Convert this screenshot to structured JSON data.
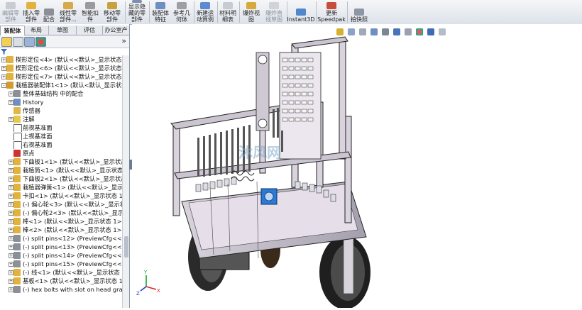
{
  "ribbon": {
    "buttons": [
      {
        "label": "编辑零\n部件",
        "disabled": true
      },
      {
        "label": "插入零\n部件",
        "disabled": false
      },
      {
        "label": "配合",
        "disabled": false
      },
      {
        "label": "线性零\n部件...",
        "disabled": false
      },
      {
        "label": "智能扣\n件",
        "disabled": false
      },
      {
        "label": "移动零\n部件",
        "disabled": false
      },
      {
        "label": "显示隐\n藏的零\n部件",
        "disabled": false
      },
      {
        "label": "装配体\n特征",
        "disabled": false
      },
      {
        "label": "参考几\n何体",
        "disabled": false
      },
      {
        "label": "新建运\n动算例",
        "disabled": false
      },
      {
        "label": "材料明\n细表",
        "disabled": false
      },
      {
        "label": "爆炸视\n图",
        "disabled": false
      },
      {
        "label": "爆炸直\n线草图",
        "disabled": true
      },
      {
        "label": "Instant3D",
        "disabled": false
      },
      {
        "label": "更新\nSpeedpak",
        "disabled": false
      },
      {
        "label": "拍快照",
        "disabled": false
      }
    ]
  },
  "panel_tabs": [
    "装配体",
    "布局",
    "草图",
    "评估",
    "办公室产品"
  ],
  "panel_expand": "»",
  "filter_icon": "filter-icon",
  "tree": [
    {
      "text": "楔形定位<4> (默认<<默认>_显示状态 1",
      "icon": "part",
      "pm": "+",
      "indent": 0
    },
    {
      "text": "楔形定位<6> (默认<<默认>_显示状态 1",
      "icon": "part",
      "pm": "+",
      "indent": 0
    },
    {
      "text": "楔形定位<7> (默认<<默认>_显示状态 1",
      "icon": "part",
      "pm": "+",
      "indent": 0
    },
    {
      "text": "栽植器装配体1<1> (默认<默认_显示状态",
      "icon": "assembly",
      "pm": "-",
      "indent": 0
    },
    {
      "text": "整体基础结构 中的配合",
      "icon": "mates",
      "pm": "+",
      "indent": 1
    },
    {
      "text": "History",
      "icon": "history",
      "pm": "+",
      "indent": 1
    },
    {
      "text": "传感器",
      "icon": "sensor",
      "pm": "",
      "indent": 1
    },
    {
      "text": "注解",
      "icon": "annotation",
      "pm": "+",
      "indent": 1
    },
    {
      "text": "前视基准面",
      "icon": "plane",
      "pm": "",
      "indent": 1
    },
    {
      "text": "上视基准面",
      "icon": "plane",
      "pm": "",
      "indent": 1
    },
    {
      "text": "右视基准面",
      "icon": "plane",
      "pm": "",
      "indent": 1
    },
    {
      "text": "原点",
      "icon": "origin",
      "pm": "",
      "indent": 1
    },
    {
      "text": "下曲板1<1> (默认<<默认>_显示状态",
      "icon": "part",
      "pm": "+",
      "indent": 1
    },
    {
      "text": "栽植筒<1> (默认<<默认>_显示状态 1",
      "icon": "part",
      "pm": "+",
      "indent": 1
    },
    {
      "text": "下曲板2<1> (默认<<默认>_显示状态",
      "icon": "part",
      "pm": "+",
      "indent": 1
    },
    {
      "text": "栽植器弹簧<1> (默认<<默认>_显示状",
      "icon": "part",
      "pm": "+",
      "indent": 1
    },
    {
      "text": "卡扣<1> (默认<<默认>_显示状态 1>)",
      "icon": "part",
      "pm": "+",
      "indent": 1
    },
    {
      "text": "(-) 偏心轮<3> (默认<<默认>_显示状",
      "icon": "part",
      "pm": "+",
      "indent": 1
    },
    {
      "text": "(-) 偏心轮2<3> (默认<<默认>_显示",
      "icon": "part",
      "pm": "+",
      "indent": 1
    },
    {
      "text": "棒<1> (默认<<默认>_显示状态 1>)",
      "icon": "part",
      "pm": "+",
      "indent": 1
    },
    {
      "text": "棒<2> (默认<<默认>_显示状态 1>)",
      "icon": "part",
      "pm": "+",
      "indent": 1
    },
    {
      "text": "(-) split pins<12> (PreviewCfg<<P",
      "icon": "pin",
      "pm": "+",
      "indent": 1
    },
    {
      "text": "(-) split pins<13> (PreviewCfg<<Pr",
      "icon": "pin",
      "pm": "+",
      "indent": 1
    },
    {
      "text": "(-) split pins<14> (PreviewCfg<<P",
      "icon": "pin",
      "pm": "+",
      "indent": 1
    },
    {
      "text": "(-) split pins<15> (PreviewCfg<<P",
      "icon": "pin",
      "pm": "+",
      "indent": 1
    },
    {
      "text": "(-) 线<1> (默认<<默认>_显示状态 1",
      "icon": "part",
      "pm": "+",
      "indent": 1
    },
    {
      "text": "基板<1> (默认<<默认>_显示状态 1>",
      "icon": "part",
      "pm": "+",
      "indent": 1
    },
    {
      "text": "(-) hex bolts with slot on head gra",
      "icon": "bolt",
      "pm": "+",
      "indent": 1
    }
  ],
  "viewport": {
    "watermark": "沐风网",
    "triad": {
      "x": "X",
      "y": "Y",
      "z": "Z"
    }
  }
}
